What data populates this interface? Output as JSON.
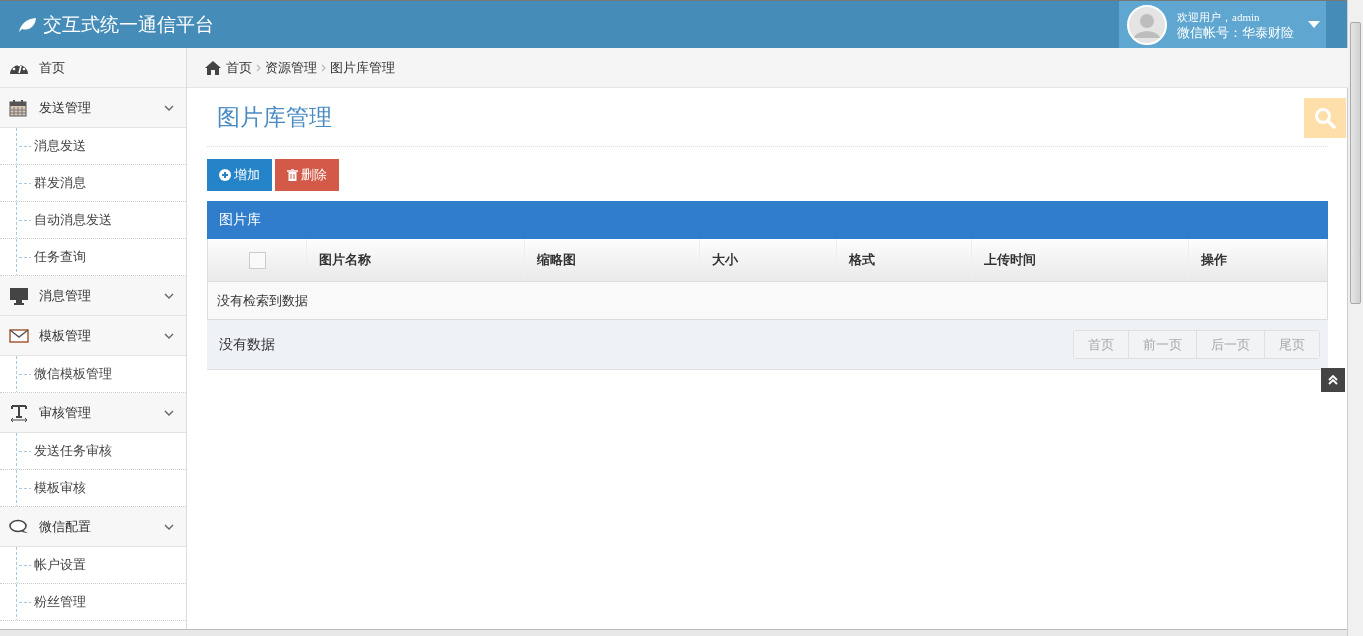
{
  "header": {
    "title": "交互式统一通信平台",
    "user": {
      "welcome": "欢迎用户，admin",
      "account": "微信帐号：华泰财险"
    }
  },
  "sidebar": {
    "items": [
      {
        "label": "首页",
        "kind": "link"
      },
      {
        "label": "发送管理",
        "kind": "menu",
        "children": [
          {
            "label": "消息发送"
          },
          {
            "label": "群发消息"
          },
          {
            "label": "自动消息发送"
          },
          {
            "label": "任务查询"
          }
        ]
      },
      {
        "label": "消息管理",
        "kind": "menu"
      },
      {
        "label": "模板管理",
        "kind": "menu",
        "children": [
          {
            "label": "微信模板管理"
          }
        ]
      },
      {
        "label": "审核管理",
        "kind": "menu",
        "children": [
          {
            "label": "发送任务审核"
          },
          {
            "label": "模板审核"
          }
        ]
      },
      {
        "label": "微信配置",
        "kind": "menu",
        "children": [
          {
            "label": "帐户设置"
          },
          {
            "label": "粉丝管理"
          }
        ]
      }
    ]
  },
  "breadcrumb": [
    "首页",
    "资源管理",
    "图片库管理"
  ],
  "page_title": "图片库管理",
  "toolbar": [
    {
      "label": "增加",
      "kind": "add"
    },
    {
      "label": "删除",
      "kind": "delete"
    }
  ],
  "panel": {
    "title": "图片库",
    "table": {
      "select_all": {
        "checked": false
      },
      "columns": [
        "图片名称",
        "缩略图",
        "大小",
        "格式",
        "上传时间",
        "操作"
      ],
      "empty_message": "没有检索到数据"
    },
    "footer": {
      "status": "没有数据",
      "pager": [
        {
          "label": "首页",
          "disabled": true
        },
        {
          "label": "前一页",
          "disabled": true
        },
        {
          "label": "后一页",
          "disabled": true
        },
        {
          "label": "尾页",
          "disabled": true
        }
      ]
    }
  }
}
